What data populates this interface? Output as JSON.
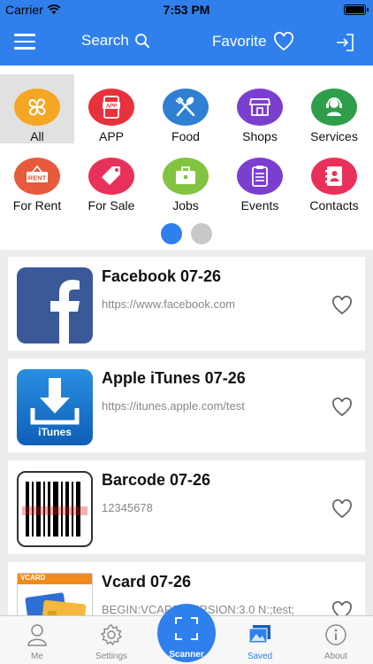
{
  "status_bar": {
    "carrier": "Carrier",
    "time": "7:53 PM"
  },
  "nav": {
    "search_label": "Search",
    "favorite_label": "Favorite"
  },
  "categories": [
    {
      "label": "All",
      "icon": "clover-icon",
      "color": "#f5a623"
    },
    {
      "label": "APP",
      "icon": "app-phone-icon",
      "color": "#e8313c"
    },
    {
      "label": "Food",
      "icon": "fork-spoon-icon",
      "color": "#2f7fd3"
    },
    {
      "label": "Shops",
      "icon": "storefront-icon",
      "color": "#7b3fd0"
    },
    {
      "label": "Services",
      "icon": "support-agent-icon",
      "color": "#2e9e4b"
    },
    {
      "label": "For Rent",
      "icon": "rent-sign-icon",
      "color": "#e85a3c"
    },
    {
      "label": "For Sale",
      "icon": "price-tag-icon",
      "color": "#e8315a"
    },
    {
      "label": "Jobs",
      "icon": "briefcase-icon",
      "color": "#82c341"
    },
    {
      "label": "Events",
      "icon": "clipboard-icon",
      "color": "#7b3fd0"
    },
    {
      "label": "Contacts",
      "icon": "address-book-icon",
      "color": "#e8315a"
    }
  ],
  "items": [
    {
      "title": "Facebook 07-26",
      "subtitle": "https://www.facebook.com",
      "icon": "facebook-icon"
    },
    {
      "title": "Apple iTunes 07-26",
      "subtitle": "https://itunes.apple.com/test",
      "icon": "itunes-icon",
      "thumb_text": "iTunes"
    },
    {
      "title": "Barcode 07-26",
      "subtitle": "12345678",
      "icon": "barcode-icon"
    },
    {
      "title": "Vcard 07-26",
      "subtitle": "BEGIN:VCARD VERSION:3.0 N:;test;",
      "icon": "vcard-icon",
      "thumb_text": "VCARD"
    }
  ],
  "tabs": [
    {
      "label": "Me",
      "icon": "person-icon"
    },
    {
      "label": "Settings",
      "icon": "gear-icon"
    },
    {
      "label": "Scanner",
      "icon": "scan-frame-icon"
    },
    {
      "label": "Saved",
      "icon": "photo-stack-icon"
    },
    {
      "label": "About",
      "icon": "info-icon"
    }
  ],
  "colors": {
    "accent": "#2f80ed",
    "selected_category_bg": "#e1e1e1"
  }
}
